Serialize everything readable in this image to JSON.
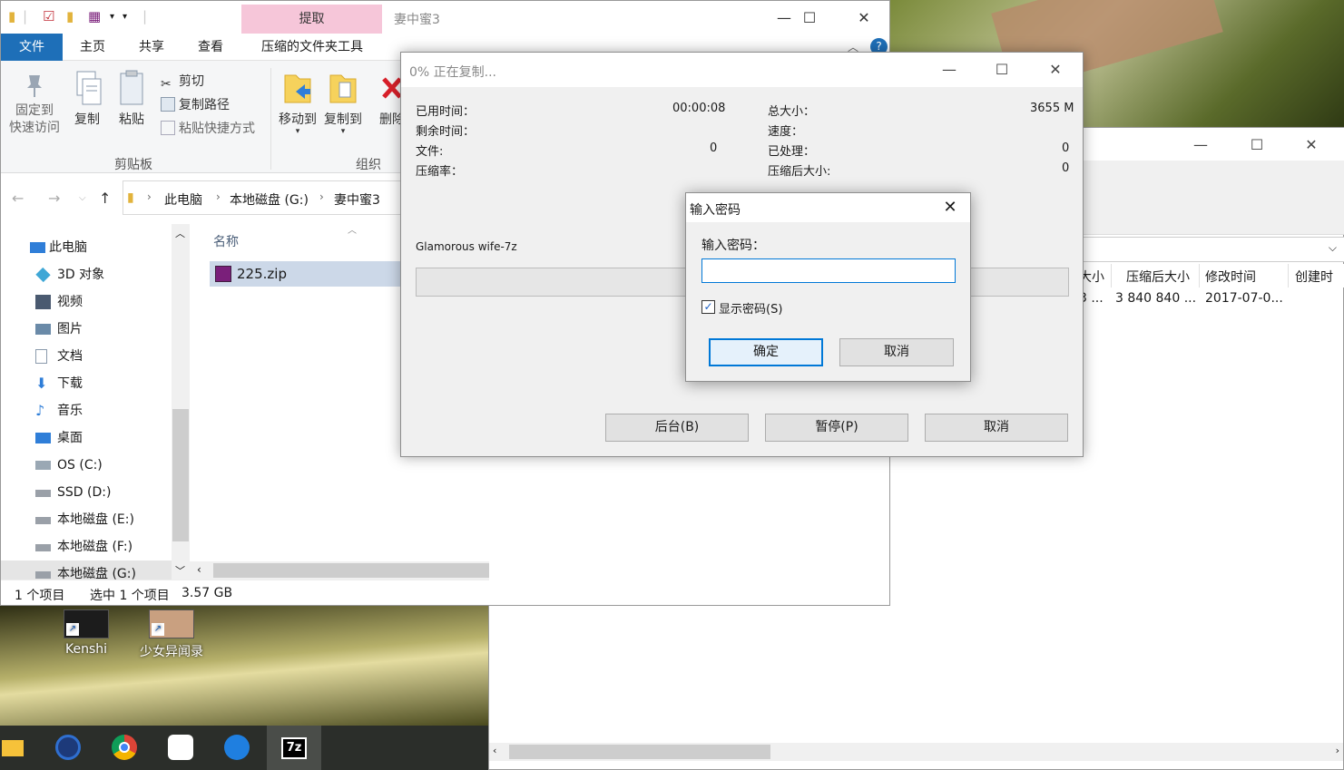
{
  "desktop": {
    "icons": [
      {
        "label": "Kenshi"
      },
      {
        "label": "少女异闻录"
      }
    ]
  },
  "explorer": {
    "title": "妻中蜜3",
    "context_tab": "提取",
    "tabs": [
      "文件",
      "主页",
      "共享",
      "查看",
      "压缩的文件夹工具"
    ],
    "ribbon": {
      "pin_line1": "固定到",
      "pin_line2": "快速访问",
      "copy": "复制",
      "paste": "粘贴",
      "cut": "剪切",
      "copy_path": "复制路径",
      "paste_shortcut": "粘贴快捷方式",
      "clipboard_group": "剪贴板",
      "move_to": "移动到",
      "copy_to": "复制到",
      "delete": "删除",
      "organize_group": "组织"
    },
    "breadcrumb": [
      "此电脑",
      "本地磁盘 (G:)",
      "妻中蜜3"
    ],
    "nav": [
      "此电脑",
      "3D 对象",
      "视频",
      "图片",
      "文档",
      "下载",
      "音乐",
      "桌面",
      "OS (C:)",
      "SSD (D:)",
      "本地磁盘 (E:)",
      "本地磁盘 (F:)",
      "本地磁盘 (G:)"
    ],
    "column_name": "名称",
    "file": {
      "name": "225.zip"
    },
    "status": {
      "count": "1 个项目",
      "selected": "选中 1 个项目",
      "size": "3.57 GB"
    }
  },
  "zip_manager": {
    "columns": [
      "大小",
      "压缩后大小",
      "修改时间",
      "创建时"
    ],
    "row": {
      "size": "3 ...",
      "packed": "3 840 840 ...",
      "modified": "2017-07-0..."
    }
  },
  "progress": {
    "title": "0% 正在复制...",
    "elapsed_label": "已用时间：",
    "elapsed_value": "00:00:08",
    "remaining_label": "剩余时间：",
    "files_label": "文件:",
    "files_value": "0",
    "ratio_label": "压缩率：",
    "total_label": "总大小：",
    "total_value": "3655 M",
    "speed_label": "速度：",
    "processed_label": "已处理：",
    "processed_value": "0",
    "packed_label": "压缩后大小:",
    "packed_value": "0",
    "current_file": "Glamorous wife-7z",
    "progress_percent": 0,
    "buttons": {
      "background": "后台(B)",
      "pause": "暂停(P)",
      "cancel": "取消"
    }
  },
  "password_dialog": {
    "title": "输入密码",
    "prompt": "输入密码：",
    "value": "",
    "show_password_label": "显示密码(S)",
    "show_password_checked": true,
    "ok": "确定",
    "cancel": "取消"
  },
  "taskbar": {
    "items": [
      "file-explorer",
      "ccleaner",
      "chrome",
      "baidu-netdisk",
      "thunder",
      "7zip"
    ],
    "active": "7zip",
    "active_label": "7z"
  }
}
